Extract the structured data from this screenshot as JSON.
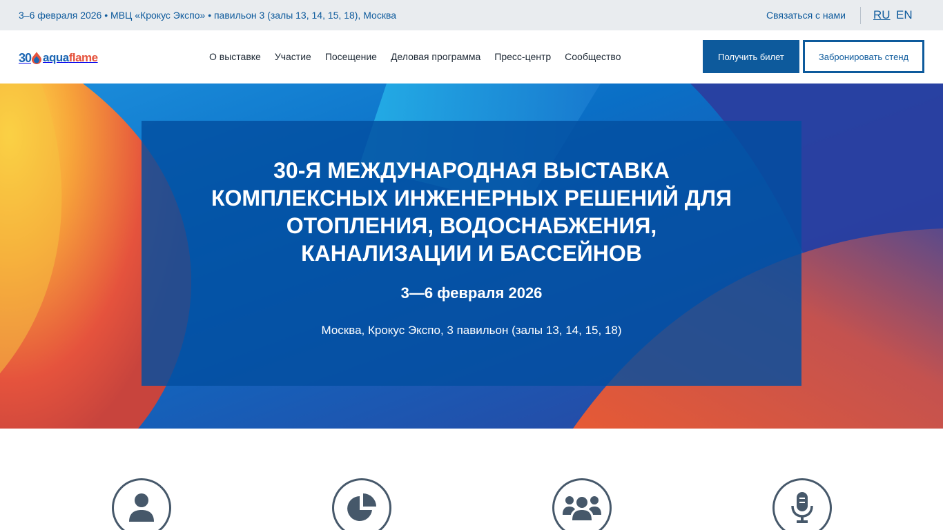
{
  "topbar": {
    "info": "3–6 февраля 2026 • МВЦ «Крокус Экспо» • павильон 3 (залы 13, 14, 15, 18), Москва",
    "contact_label": "Связаться с нами",
    "lang_ru": "RU",
    "lang_en": "EN"
  },
  "logo": {
    "number": "30",
    "word_aqua": "aqua",
    "word_flame": "flame"
  },
  "nav": {
    "items": [
      {
        "label": "О выставке"
      },
      {
        "label": "Участие"
      },
      {
        "label": "Посещение"
      },
      {
        "label": "Деловая программа"
      },
      {
        "label": "Пресс-центр"
      },
      {
        "label": "Сообщество"
      }
    ]
  },
  "buttons": {
    "ticket_label": "Получить билет",
    "stand_label": "Забронировать стенд"
  },
  "hero": {
    "title_line1": "30-Я МЕЖДУНАРОДНАЯ ВЫСТАВКА",
    "title_line2": "КОМПЛЕКСНЫХ ИНЖЕНЕРНЫХ РЕШЕНИЙ ДЛЯ",
    "title_line3": "ОТОПЛЕНИЯ, ВОДОСНАБЖЕНИЯ,",
    "title_line4": "КАНАЛИЗАЦИИ И БАССЕЙНОВ",
    "date": "3—6 февраля 2026",
    "place": "Москва, Крокус Экспо, 3 павильон (залы 13, 14, 15, 18)"
  },
  "features": [
    {
      "icon": "user-icon"
    },
    {
      "icon": "pie-chart-icon"
    },
    {
      "icon": "group-icon"
    },
    {
      "icon": "microphone-icon"
    }
  ],
  "colors": {
    "brand_blue": "#0d5a9c",
    "flame_red": "#e5533d",
    "topbar_bg": "#e9ecef",
    "icon_gray": "#46586a"
  }
}
